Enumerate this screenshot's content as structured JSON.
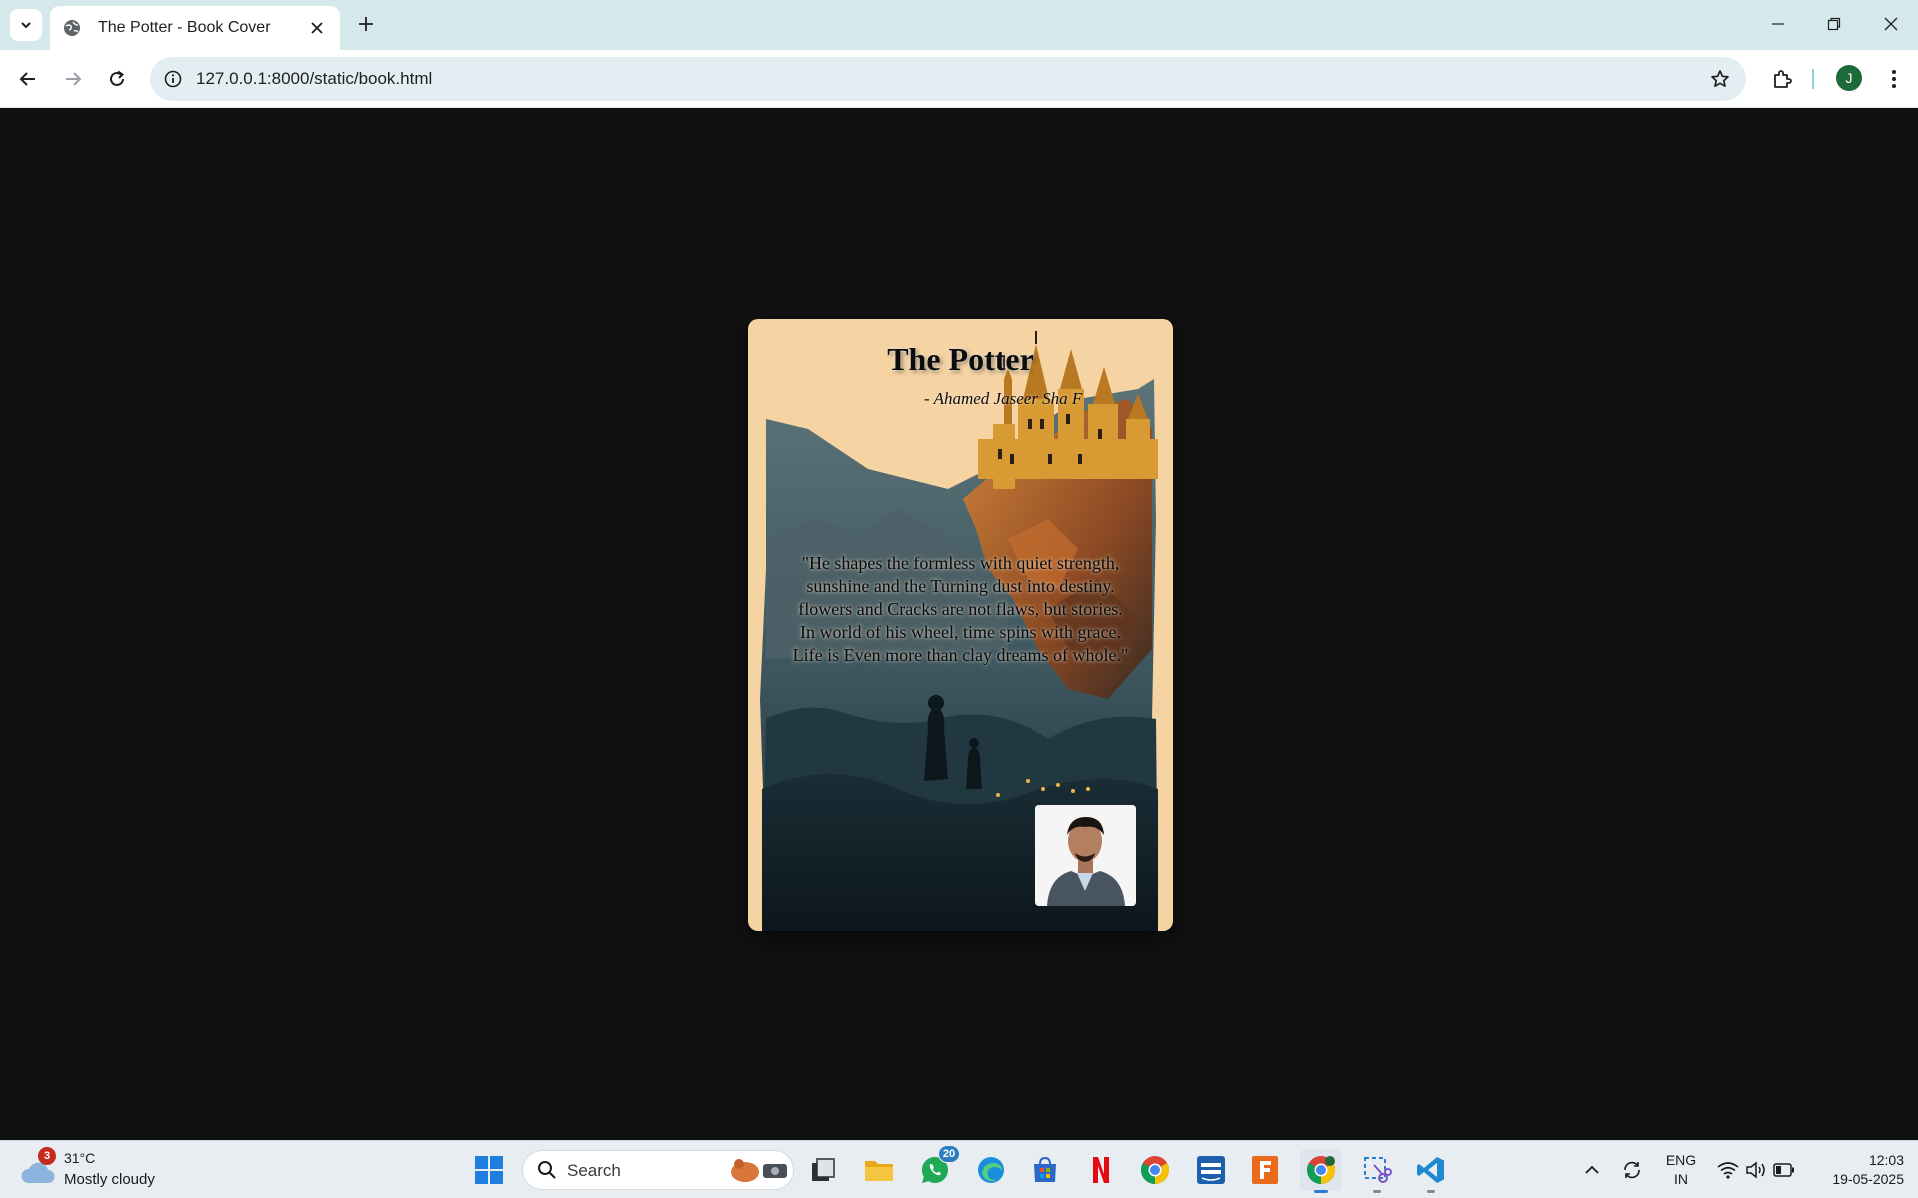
{
  "browser": {
    "tab_title": "The Potter - Book Cover",
    "url": "127.0.0.1:8000/static/book.html",
    "profile_initial": "J"
  },
  "page": {
    "title": "The Potter",
    "author": "- Ahamed Jaseer Sha F",
    "quote_lines": [
      "\"He shapes the formless with quiet strength,",
      "sunshine and the Turning dust into destiny.",
      "flowers and Cracks are not flaws, but stories.",
      "In world of his wheel, time spins with grace.",
      "Life is Even more than clay dreams of whole.\""
    ],
    "background_color": "#111111",
    "cover_color": "#f6d3a3"
  },
  "taskbar": {
    "weather_temp": "31°C",
    "weather_desc": "Mostly cloudy",
    "weather_badge": "3",
    "search_label": "Search",
    "whatsapp_badge": "20",
    "lang_line1": "ENG",
    "lang_line2": "IN",
    "time": "12:03",
    "date": "19-05-2025"
  },
  "icons": [
    "tab-search-icon",
    "globe-icon",
    "close-icon",
    "plus-icon",
    "minimize-icon",
    "restore-icon",
    "back-icon",
    "forward-icon",
    "reload-icon",
    "info-icon",
    "star-icon",
    "extensions-icon",
    "kebab-menu-icon",
    "windows-start-icon",
    "search-icon",
    "file-explorer-icon",
    "whatsapp-icon",
    "edge-icon",
    "store-icon",
    "netflix-icon",
    "chrome-icon",
    "prime-video-icon",
    "fusion-icon",
    "snipping-tool-icon",
    "vscode-icon",
    "chevron-up-icon",
    "sync-icon",
    "wifi-icon",
    "volume-icon",
    "battery-icon"
  ]
}
